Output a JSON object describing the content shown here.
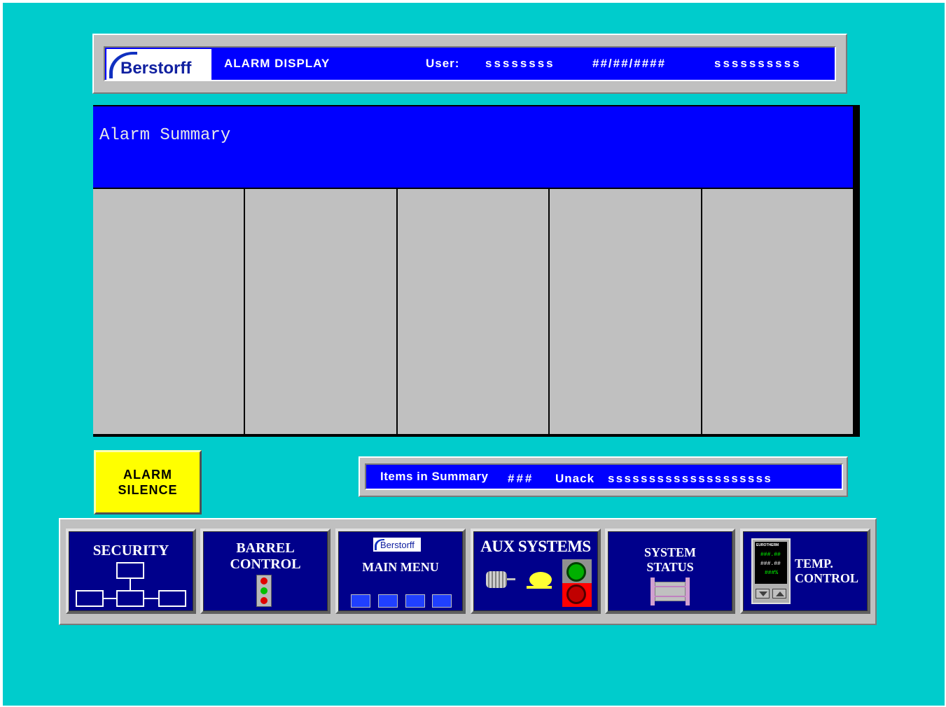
{
  "header": {
    "brand": "Berstorff",
    "screen_title": "ALARM DISPLAY",
    "user_label": "User:",
    "user_value": "ssssssss",
    "date": "##/##/####",
    "time": "ssssssssss"
  },
  "alarm_summary": {
    "title": "Alarm Summary",
    "column_count": 5
  },
  "alarm_silence": {
    "line1": "ALARM",
    "line2": "SILENCE"
  },
  "summary_status": {
    "items_label": "Items in Summary",
    "items_value": "###",
    "unack_label": "Unack",
    "unack_value": "ssssssssssssssssssss"
  },
  "nav": {
    "security": "SECURITY",
    "barrel_line1": "BARREL",
    "barrel_line2": "CONTROL",
    "main_menu_brand": "Berstorff",
    "main_menu": "MAIN MENU",
    "aux_systems": "AUX SYSTEMS",
    "system_line1": "SYSTEM",
    "system_line2": "STATUS",
    "temp_line1": "TEMP.",
    "temp_line2": "CONTROL",
    "eurotherm_brand": "EUROTHERM",
    "eurotherm_pv": "###.##",
    "eurotherm_sp": "###.##",
    "eurotherm_out": "###%"
  },
  "colors": {
    "background": "#00cccc",
    "accent_blue": "#0000ff",
    "nav_blue": "#00008b",
    "alarm_button": "#ffff00",
    "panel_gray": "#c0c0c0"
  },
  "icons": [
    "flowchart-icon",
    "stack-light-icon",
    "mini-screens-icon",
    "motor-icon",
    "blower-icon",
    "start-stop-icon",
    "system-diagram-icon",
    "controller-icon"
  ]
}
